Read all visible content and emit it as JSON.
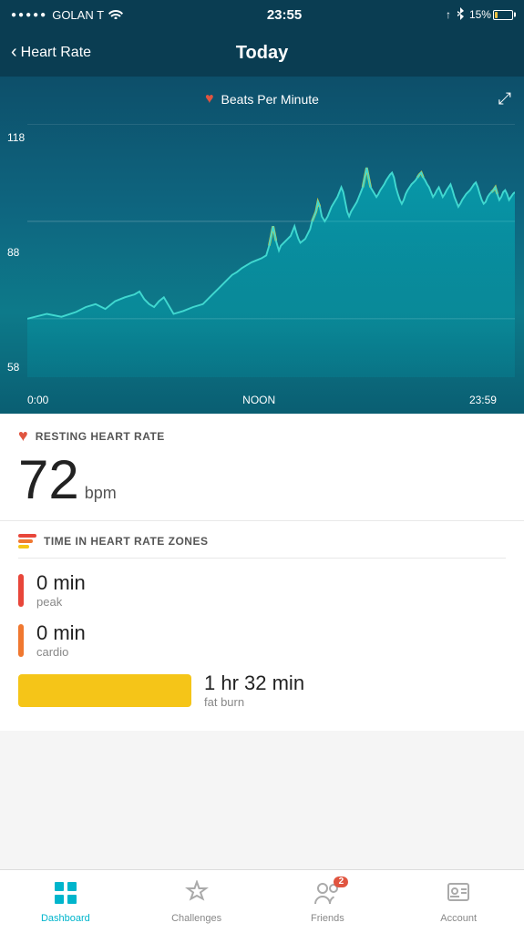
{
  "statusBar": {
    "carrier": "GOLAN T",
    "time": "23:55",
    "battery": "15%"
  },
  "header": {
    "backLabel": "Heart Rate",
    "title": "Today"
  },
  "chart": {
    "legend": "Beats Per Minute",
    "yLabels": [
      "118",
      "88",
      "58"
    ],
    "xLabels": [
      "0:00",
      "NOON",
      "23:59"
    ]
  },
  "restingHeartRate": {
    "sectionTitle": "RESTING HEART RATE",
    "value": "72",
    "unit": "bpm"
  },
  "zones": {
    "sectionTitle": "TIME IN HEART RATE ZONES",
    "peak": {
      "duration": "0 min",
      "label": "peak"
    },
    "cardio": {
      "duration": "0 min",
      "label": "cardio"
    },
    "fatBurn": {
      "duration": "1 hr 32 min",
      "label": "fat burn"
    }
  },
  "bottomNav": {
    "items": [
      {
        "id": "dashboard",
        "label": "Dashboard",
        "active": true
      },
      {
        "id": "challenges",
        "label": "Challenges",
        "active": false
      },
      {
        "id": "friends",
        "label": "Friends",
        "active": false,
        "badge": "2"
      },
      {
        "id": "account",
        "label": "Account",
        "active": false
      }
    ]
  }
}
